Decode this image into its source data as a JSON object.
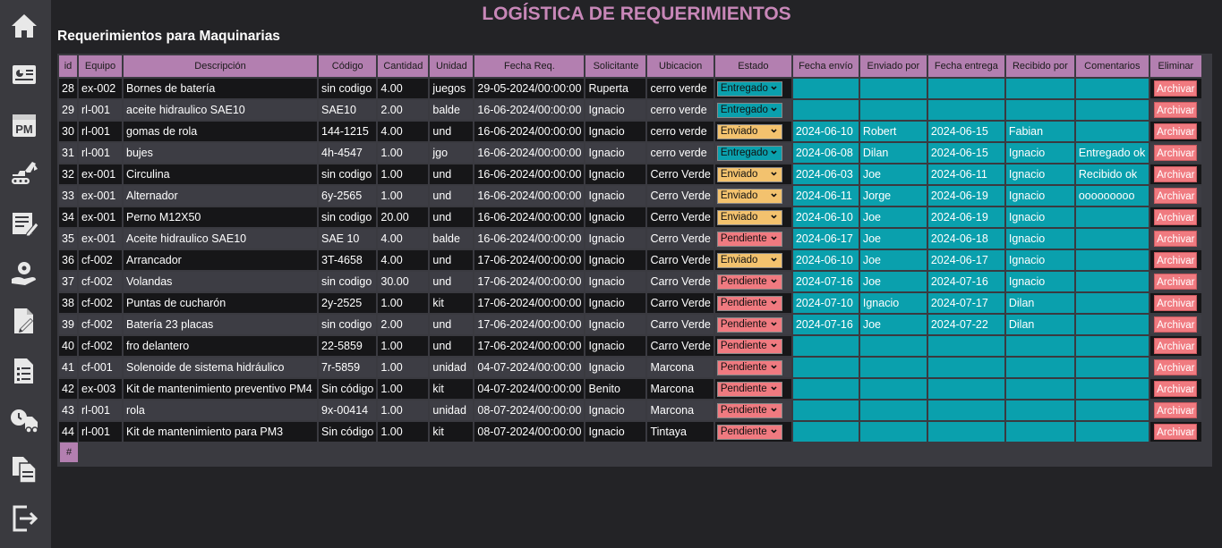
{
  "title": "LOGÍSTICA DE REQUERIMIENTOS",
  "subtitle": "Requerimientos para Maquinarias",
  "colors": {
    "entregado": "#0aa0ad",
    "enviado": "#f3c26e",
    "pendiente": "#f07a80",
    "header": "#b37fb0",
    "title": "#c887b8"
  },
  "sidebar": [
    {
      "icon": "home-icon"
    },
    {
      "icon": "dashboard-icon"
    },
    {
      "icon": "pm-calendar-icon",
      "label": "PM"
    },
    {
      "icon": "excavator-icon"
    },
    {
      "icon": "edit-list-icon"
    },
    {
      "icon": "gear-hand-icon"
    },
    {
      "icon": "document-edit-icon"
    },
    {
      "icon": "document-list-icon"
    },
    {
      "icon": "delivery-truck-icon"
    },
    {
      "icon": "copy-documents-icon"
    },
    {
      "icon": "logout-icon"
    }
  ],
  "columns": [
    "id",
    "Equipo",
    "Descripción",
    "Código",
    "Cantidad",
    "Unidad",
    "Fecha Req.",
    "Solicitante",
    "Ubicacion",
    "Estado",
    "Fecha envío",
    "Enviado por",
    "Fecha entrega",
    "Recibido por",
    "Comentarios",
    "Eliminar"
  ],
  "archive_label": "Archivar",
  "footer_hash": "#",
  "rows": [
    {
      "id": "28",
      "equipo": "ex-002",
      "descripcion": "Bornes de batería",
      "codigo": "sin codigo",
      "cantidad": "4.00",
      "unidad": "juegos",
      "fecha_req": "29-05-2024/00:00:00",
      "solicitante": "Ruperta",
      "ubicacion": "cerro verde",
      "estado": "Entregado",
      "fecha_envio": "",
      "enviado_por": "",
      "fecha_entrega": "",
      "recibido_por": "",
      "comentarios": ""
    },
    {
      "id": "29",
      "equipo": "rl-001",
      "descripcion": "aceite hidraulico SAE10",
      "codigo": "SAE10",
      "cantidad": "2.00",
      "unidad": "balde",
      "fecha_req": "16-06-2024/00:00:00",
      "solicitante": "Ignacio",
      "ubicacion": "cerro verde",
      "estado": "Entregado",
      "fecha_envio": "",
      "enviado_por": "",
      "fecha_entrega": "",
      "recibido_por": "",
      "comentarios": ""
    },
    {
      "id": "30",
      "equipo": "rl-001",
      "descripcion": "gomas de rola",
      "codigo": "144-1215",
      "cantidad": "4.00",
      "unidad": "und",
      "fecha_req": "16-06-2024/00:00:00",
      "solicitante": "Ignacio",
      "ubicacion": "cerro verde",
      "estado": "Enviado",
      "fecha_envio": "2024-06-10",
      "enviado_por": "Robert",
      "fecha_entrega": "2024-06-15",
      "recibido_por": "Fabian",
      "comentarios": ""
    },
    {
      "id": "31",
      "equipo": "rl-001",
      "descripcion": "bujes",
      "codigo": "4h-4547",
      "cantidad": "1.00",
      "unidad": "jgo",
      "fecha_req": "16-06-2024/00:00:00",
      "solicitante": "Ignacio",
      "ubicacion": "cerro verde",
      "estado": "Entregado",
      "fecha_envio": "2024-06-08",
      "enviado_por": "Dilan",
      "fecha_entrega": "2024-06-15",
      "recibido_por": "Ignacio",
      "comentarios": "Entregado ok"
    },
    {
      "id": "32",
      "equipo": "ex-001",
      "descripcion": "Circulina",
      "codigo": "sin codigo",
      "cantidad": "1.00",
      "unidad": "und",
      "fecha_req": "16-06-2024/00:00:00",
      "solicitante": "Ignacio",
      "ubicacion": "Cerro Verde",
      "estado": "Enviado",
      "fecha_envio": "2024-06-03",
      "enviado_por": "Joe",
      "fecha_entrega": "2024-06-11",
      "recibido_por": "Ignacio",
      "comentarios": "Recibido ok"
    },
    {
      "id": "33",
      "equipo": "ex-001",
      "descripcion": "Alternador",
      "codigo": "6y-2565",
      "cantidad": "1.00",
      "unidad": "und",
      "fecha_req": "16-06-2024/00:00:00",
      "solicitante": "Ignacio",
      "ubicacion": "Cerro Verde",
      "estado": "Enviado",
      "fecha_envio": "2024-06-11",
      "enviado_por": "Jorge",
      "fecha_entrega": "2024-06-19",
      "recibido_por": "Ignacio",
      "comentarios": "ooooooooo"
    },
    {
      "id": "34",
      "equipo": "ex-001",
      "descripcion": "Perno M12X50",
      "codigo": "sin codigo",
      "cantidad": "20.00",
      "unidad": "und",
      "fecha_req": "16-06-2024/00:00:00",
      "solicitante": "Ignacio",
      "ubicacion": "Cerro Verde",
      "estado": "Enviado",
      "fecha_envio": "2024-06-10",
      "enviado_por": "Joe",
      "fecha_entrega": "2024-06-19",
      "recibido_por": "Ignacio",
      "comentarios": ""
    },
    {
      "id": "35",
      "equipo": "ex-001",
      "descripcion": "Aceite hidraulico SAE10",
      "codigo": "SAE 10",
      "cantidad": "4.00",
      "unidad": "balde",
      "fecha_req": "16-06-2024/00:00:00",
      "solicitante": "Ignacio",
      "ubicacion": "Cerro Verde",
      "estado": "Pendiente",
      "fecha_envio": "2024-06-17",
      "enviado_por": "Joe",
      "fecha_entrega": "2024-06-18",
      "recibido_por": "Ignacio",
      "comentarios": ""
    },
    {
      "id": "36",
      "equipo": "cf-002",
      "descripcion": "Arrancador",
      "codigo": "3T-4658",
      "cantidad": "4.00",
      "unidad": "und",
      "fecha_req": "17-06-2024/00:00:00",
      "solicitante": "Ignacio",
      "ubicacion": "Carro Verde",
      "estado": "Enviado",
      "fecha_envio": "2024-06-10",
      "enviado_por": "Joe",
      "fecha_entrega": "2024-06-17",
      "recibido_por": "Ignacio",
      "comentarios": ""
    },
    {
      "id": "37",
      "equipo": "cf-002",
      "descripcion": "Volandas",
      "codigo": "sin codigo",
      "cantidad": "30.00",
      "unidad": "und",
      "fecha_req": "17-06-2024/00:00:00",
      "solicitante": "Ignacio",
      "ubicacion": "Carro Verde",
      "estado": "Pendiente",
      "fecha_envio": "2024-07-16",
      "enviado_por": "Joe",
      "fecha_entrega": "2024-07-16",
      "recibido_por": "Ignacio",
      "comentarios": ""
    },
    {
      "id": "38",
      "equipo": "cf-002",
      "descripcion": "Puntas de cucharón",
      "codigo": "2y-2525",
      "cantidad": "1.00",
      "unidad": "kit",
      "fecha_req": "17-06-2024/00:00:00",
      "solicitante": "Ignacio",
      "ubicacion": "Carro Verde",
      "estado": "Pendiente",
      "fecha_envio": "2024-07-10",
      "enviado_por": "Ignacio",
      "fecha_entrega": "2024-07-17",
      "recibido_por": "Dilan",
      "comentarios": ""
    },
    {
      "id": "39",
      "equipo": "cf-002",
      "descripcion": "Batería 23 placas",
      "codigo": "sin codigo",
      "cantidad": "2.00",
      "unidad": "und",
      "fecha_req": "17-06-2024/00:00:00",
      "solicitante": "Ignacio",
      "ubicacion": "Carro Verde",
      "estado": "Pendiente",
      "fecha_envio": "2024-07-16",
      "enviado_por": "Joe",
      "fecha_entrega": "2024-07-22",
      "recibido_por": "Dilan",
      "comentarios": ""
    },
    {
      "id": "40",
      "equipo": "cf-002",
      "descripcion": "fro delantero",
      "codigo": "22-5859",
      "cantidad": "1.00",
      "unidad": "und",
      "fecha_req": "17-06-2024/00:00:00",
      "solicitante": "Ignacio",
      "ubicacion": "Carro Verde",
      "estado": "Pendiente",
      "fecha_envio": "",
      "enviado_por": "",
      "fecha_entrega": "",
      "recibido_por": "",
      "comentarios": ""
    },
    {
      "id": "41",
      "equipo": "cf-001",
      "descripcion": "Solenoide de sistema hidráulico",
      "codigo": "7r-5859",
      "cantidad": "1.00",
      "unidad": "unidad",
      "fecha_req": "04-07-2024/00:00:00",
      "solicitante": "Ignacio",
      "ubicacion": "Marcona",
      "estado": "Pendiente",
      "fecha_envio": "",
      "enviado_por": "",
      "fecha_entrega": "",
      "recibido_por": "",
      "comentarios": ""
    },
    {
      "id": "42",
      "equipo": "ex-003",
      "descripcion": "Kit de mantenimiento preventivo PM4",
      "codigo": "Sin código",
      "cantidad": "1.00",
      "unidad": "kit",
      "fecha_req": "04-07-2024/00:00:00",
      "solicitante": "Benito",
      "ubicacion": "Marcona",
      "estado": "Pendiente",
      "fecha_envio": "",
      "enviado_por": "",
      "fecha_entrega": "",
      "recibido_por": "",
      "comentarios": ""
    },
    {
      "id": "43",
      "equipo": "rl-001",
      "descripcion": "rola",
      "codigo": "9x-00414",
      "cantidad": "1.00",
      "unidad": "unidad",
      "fecha_req": "08-07-2024/00:00:00",
      "solicitante": "Ignacio",
      "ubicacion": "Marcona",
      "estado": "Pendiente",
      "fecha_envio": "",
      "enviado_por": "",
      "fecha_entrega": "",
      "recibido_por": "",
      "comentarios": ""
    },
    {
      "id": "44",
      "equipo": "rl-001",
      "descripcion": "Kit de mantenimiento para PM3",
      "codigo": "Sin código",
      "cantidad": "1.00",
      "unidad": "kit",
      "fecha_req": "08-07-2024/00:00:00",
      "solicitante": "Ignacio",
      "ubicacion": "Tintaya",
      "estado": "Pendiente",
      "fecha_envio": "",
      "enviado_por": "",
      "fecha_entrega": "",
      "recibido_por": "",
      "comentarios": ""
    }
  ]
}
